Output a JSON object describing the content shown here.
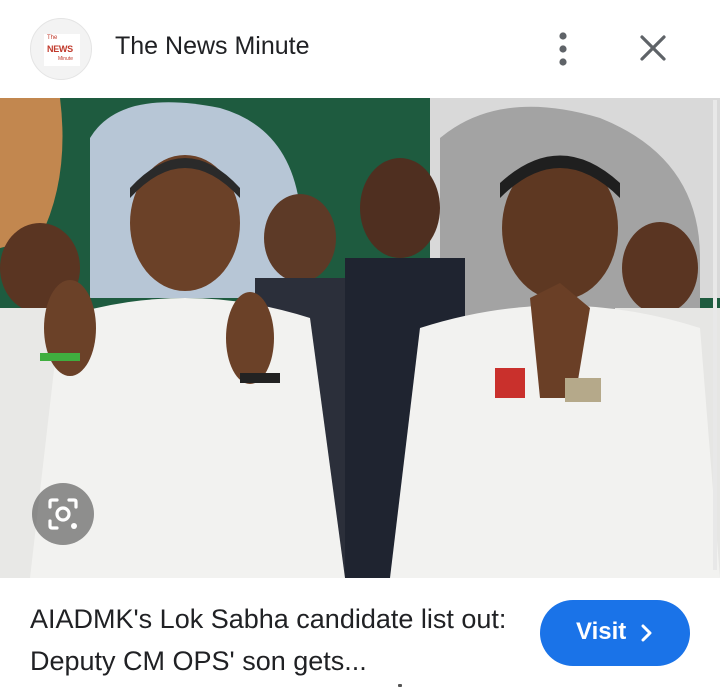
{
  "header": {
    "logo": {
      "line1": "The",
      "line2": "NEWS",
      "line3": "Minute"
    },
    "site_name": "The News Minute",
    "more_icon": "more-vert-icon",
    "close_icon": "close-icon"
  },
  "image": {
    "description_icon": "google-lens-icon"
  },
  "caption": {
    "text": "AIADMK's Lok Sabha candidate list out: Deputy CM OPS' son gets..."
  },
  "visit": {
    "label": "Visit",
    "icon": "chevron-right-icon"
  },
  "colors": {
    "accent": "#1a73e8",
    "text": "#202124",
    "backdrop_green": "#1d5a3c",
    "shirt_white": "#f2f2f0"
  }
}
